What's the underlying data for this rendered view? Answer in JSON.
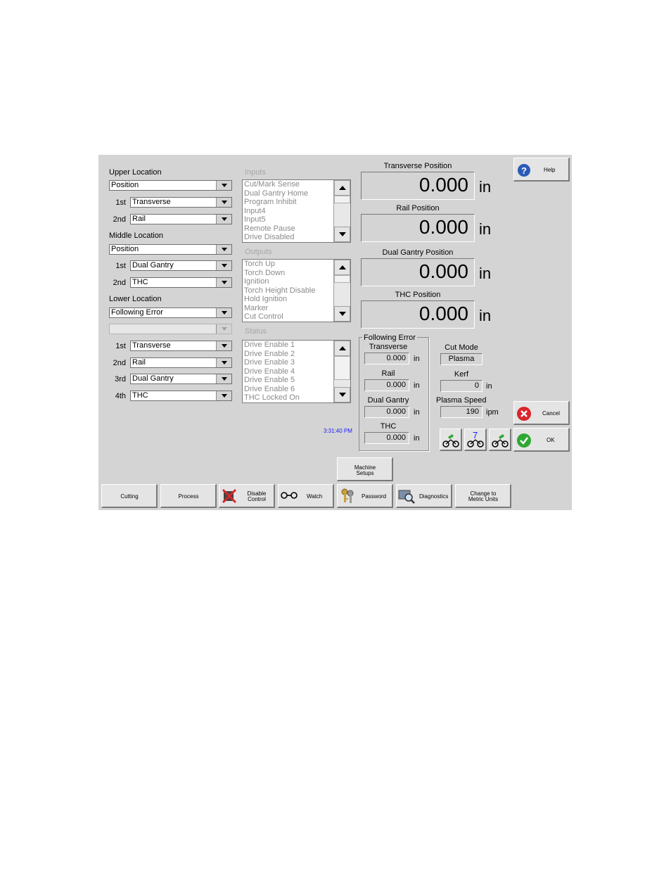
{
  "upper_location": {
    "label": "Upper Location",
    "mode": "Position",
    "first_label": "1st",
    "first": "Transverse",
    "second_label": "2nd",
    "second": "Rail"
  },
  "middle_location": {
    "label": "Middle Location",
    "mode": "Position",
    "first_label": "1st",
    "first": "Dual Gantry",
    "second_label": "2nd",
    "second": "THC"
  },
  "lower_location": {
    "label": "Lower Location",
    "mode": "Following Error",
    "extra": "",
    "first_label": "1st",
    "first": "Transverse",
    "second_label": "2nd",
    "second": "Rail",
    "third_label": "3rd",
    "third": "Dual Gantry",
    "fourth_label": "4th",
    "fourth": "THC"
  },
  "inputs": {
    "label": "Inputs",
    "items": [
      "Cut/Mark Sense",
      "Dual Gantry Home",
      "Program Inhibit",
      "Input4",
      "Input5",
      "Remote Pause",
      "Drive Disabled"
    ]
  },
  "outputs": {
    "label": "Outputs",
    "items": [
      "Torch Up",
      "Torch Down",
      "Ignition",
      "Torch Height Disable",
      "Hold Ignition",
      "Marker",
      "Cut Control"
    ]
  },
  "status": {
    "label": "Status",
    "items": [
      "Drive Enable 1",
      "Drive Enable 2",
      "Drive Enable 3",
      "Drive Enable 4",
      "Drive Enable 5",
      "Drive Enable 6",
      "THC Locked On"
    ]
  },
  "time": "3:31:40 PM",
  "positions": {
    "transverse": {
      "title": "Transverse Position",
      "value": "0.000",
      "unit": "in"
    },
    "rail": {
      "title": "Rail Position",
      "value": "0.000",
      "unit": "in"
    },
    "dual_gantry": {
      "title": "Dual Gantry Position",
      "value": "0.000",
      "unit": "in"
    },
    "thc": {
      "title": "THC Position",
      "value": "0.000",
      "unit": "in"
    }
  },
  "following_error": {
    "title": "Following Error",
    "transverse": {
      "label": "Transverse",
      "value": "0.000",
      "unit": "in"
    },
    "rail": {
      "label": "Rail",
      "value": "0.000",
      "unit": "in"
    },
    "dual_gantry": {
      "label": "Dual Gantry",
      "value": "0.000",
      "unit": "in"
    },
    "thc": {
      "label": "THC",
      "value": "0.000",
      "unit": "in"
    }
  },
  "cut_mode": {
    "label": "Cut Mode",
    "value": "Plasma"
  },
  "kerf": {
    "label": "Kerf",
    "value": "0",
    "unit": "in"
  },
  "plasma_speed": {
    "label": "Plasma Speed",
    "value": "190",
    "unit": "ipm"
  },
  "station_digit": "7",
  "buttons": {
    "help": "Help",
    "cancel": "Cancel",
    "ok": "OK",
    "machine_setups_1": "Machine",
    "machine_setups_2": "Setups",
    "cutting": "Cutting",
    "process": "Process",
    "disable_control_1": "Disable",
    "disable_control_2": "Control",
    "watch": "Watch",
    "password": "Password",
    "diagnostics": "Diagnostics",
    "metric_1": "Change to",
    "metric_2": "Metric Units"
  },
  "icons": {
    "help": "question-circle-icon",
    "cancel": "red-x-circle-icon",
    "ok": "green-check-circle-icon",
    "disable": "red-x-icon",
    "watch": "binoculars-icon",
    "password": "keys-icon",
    "diagnostics": "magnifier-icon",
    "torch": "torch-station-icon"
  },
  "colors": {
    "panel": "#d4d4d4",
    "time": "#1a1aff",
    "cancel": "#d9262c",
    "ok": "#2fa833"
  }
}
